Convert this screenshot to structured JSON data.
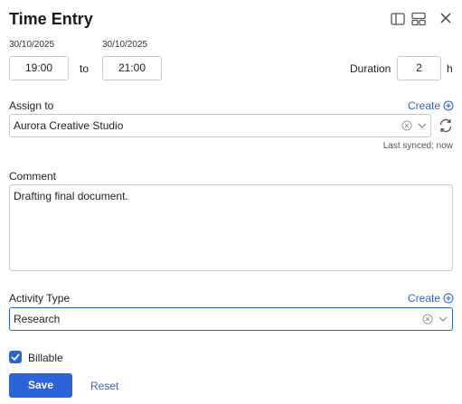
{
  "header": {
    "title": "Time Entry",
    "icons": [
      "sidebar-panel-icon",
      "layout-icon",
      "close-icon"
    ]
  },
  "time": {
    "start_date": "30/10/2025",
    "end_date": "30/10/2025",
    "start_time": "19:00",
    "end_time": "21:00",
    "to_label": "to",
    "duration_label": "Duration",
    "duration_value": "2",
    "duration_unit": "h"
  },
  "assign": {
    "label": "Assign to",
    "create_label": "Create",
    "value": "Aurora Creative Studio",
    "last_synced": "Last synced: now"
  },
  "comment": {
    "label": "Comment",
    "value": "Drafting final document."
  },
  "activity": {
    "label": "Activity Type",
    "create_label": "Create",
    "value": "Research"
  },
  "billable": {
    "label": "Billable",
    "checked": true
  },
  "actions": {
    "save_label": "Save",
    "reset_label": "Reset"
  },
  "colors": {
    "accent": "#2b63d9",
    "border": "#c9c9c9",
    "text": "#222222"
  }
}
